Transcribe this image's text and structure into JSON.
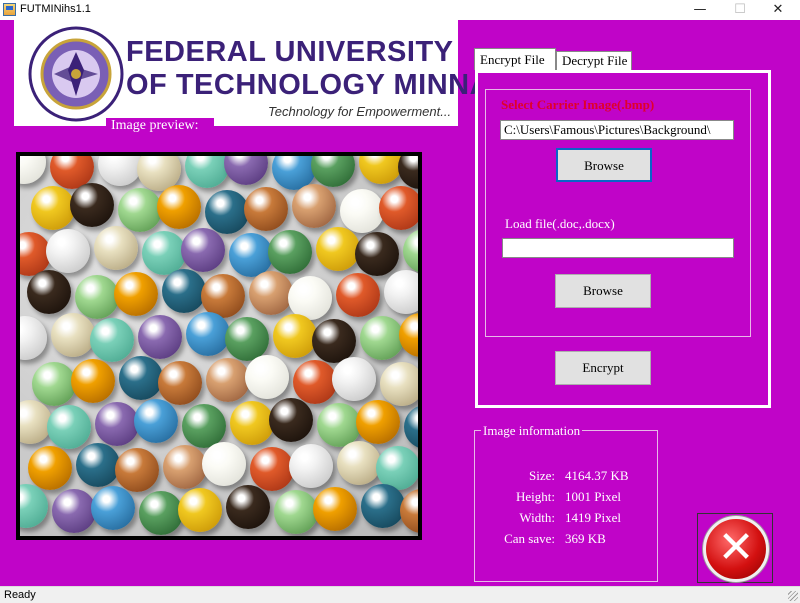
{
  "window": {
    "title": "FUTMINihs1.1",
    "minimize_glyph": "—",
    "maximize_glyph": "☐",
    "close_glyph": "✕"
  },
  "logo": {
    "line1": "FEDERAL UNIVERSITY",
    "line2": "OF TECHNOLOGY MINNA",
    "tagline": "Technology for Empowerment...",
    "seal_icon": "university-seal"
  },
  "preview": {
    "label": "Image preview:"
  },
  "tabs": [
    {
      "label": "Encrypt File",
      "active": true
    },
    {
      "label": "Decrypt File",
      "active": false
    }
  ],
  "encrypt": {
    "carrier_label": "Select Carrier Image(.bmp)",
    "carrier_value": "C:\\Users\\Famous\\Pictures\\Background\\",
    "browse1_label": "Browse",
    "load_label": "Load file(.doc,.docx)",
    "load_value": "",
    "browse2_label": "Browse",
    "encrypt_label": "Encrypt"
  },
  "info": {
    "title": "Image information",
    "rows": [
      {
        "label": "Size:",
        "value": "4164.37 KB"
      },
      {
        "label": "Height:",
        "value": "1001 Pixel"
      },
      {
        "label": "Width:",
        "value": "1419 Pixel"
      },
      {
        "label": "Can save:",
        "value": "369 KB"
      }
    ]
  },
  "exit_button": {
    "icon": "close-x-icon",
    "color": "#d31010"
  },
  "status": {
    "text": "Ready"
  },
  "colors": {
    "background": "#c004c8",
    "accent_red": "#e0002a",
    "logo_text": "#3b2178"
  }
}
